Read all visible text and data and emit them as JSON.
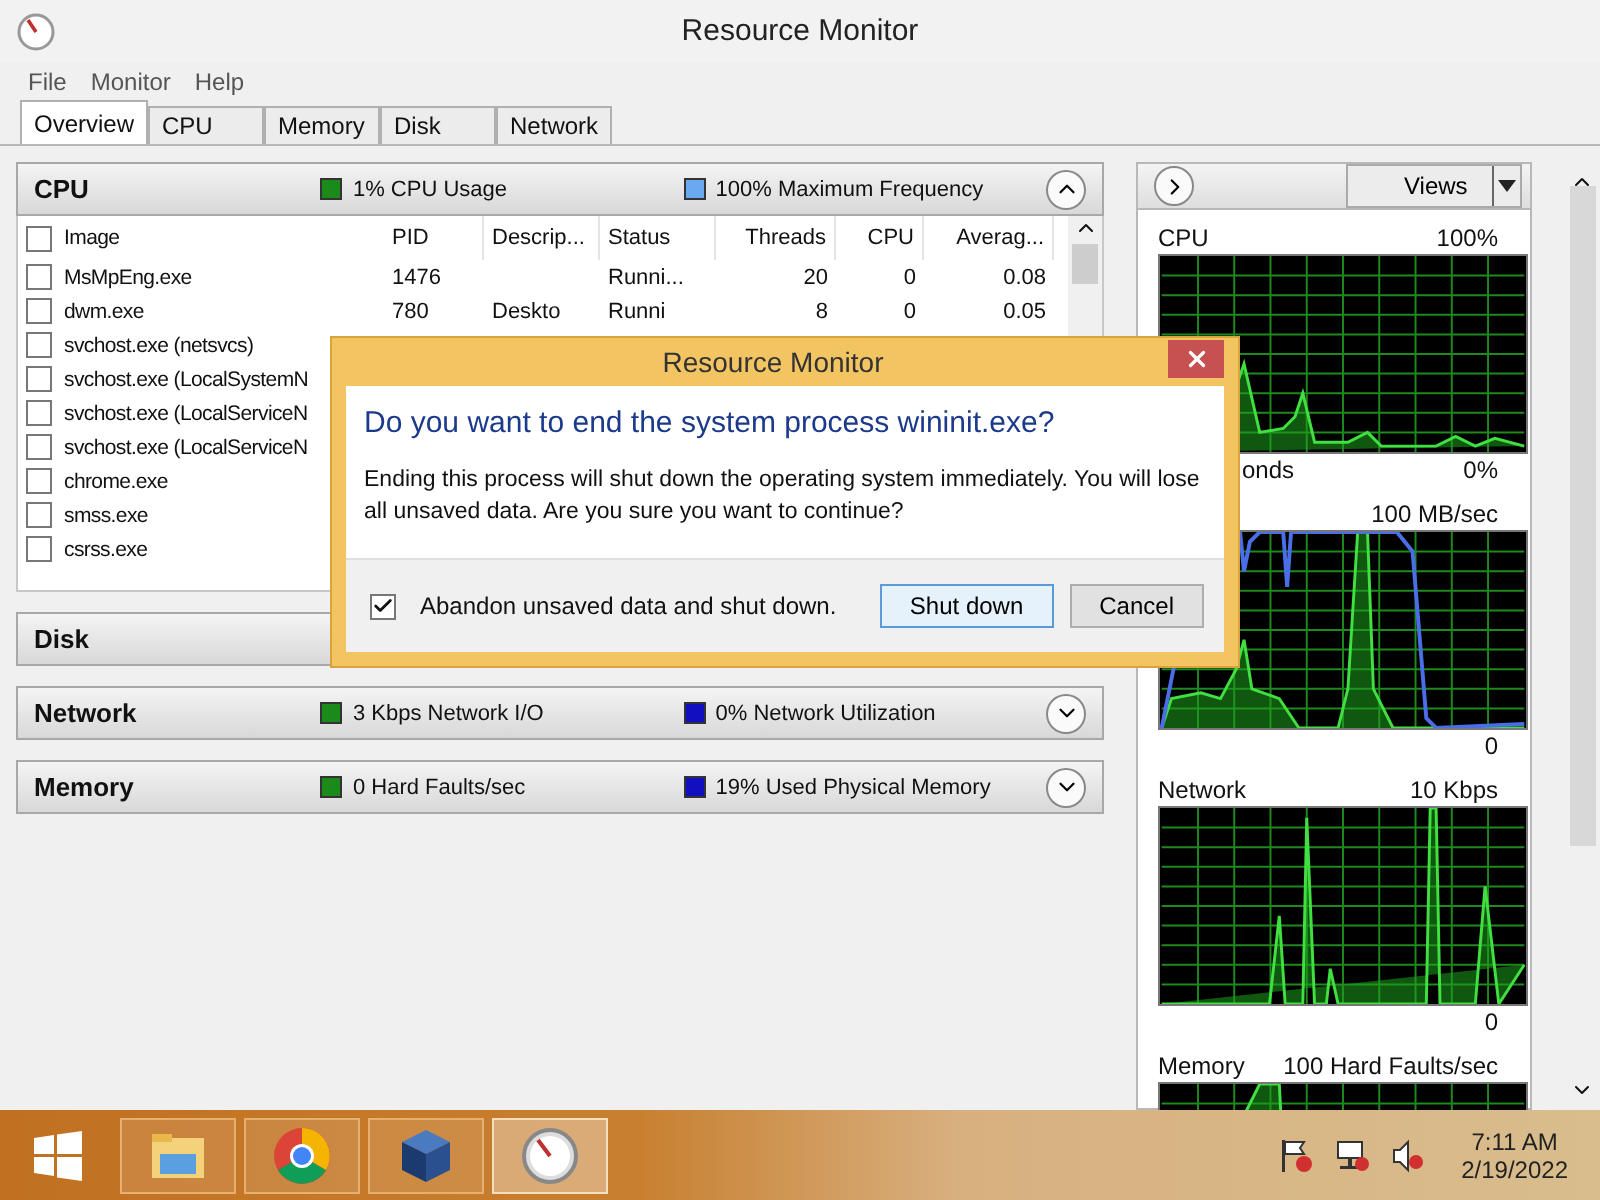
{
  "window": {
    "title": "Resource Monitor"
  },
  "menu": [
    "File",
    "Monitor",
    "Help"
  ],
  "tabs": [
    {
      "label": "Overview",
      "selected": true
    },
    {
      "label": "CPU",
      "selected": false
    },
    {
      "label": "Memory",
      "selected": false
    },
    {
      "label": "Disk",
      "selected": false
    },
    {
      "label": "Network",
      "selected": false
    }
  ],
  "sections": [
    {
      "title": "CPU",
      "expanded": true,
      "indicators": [
        {
          "text": "1% CPU Usage",
          "color": "#1a8a1a"
        },
        {
          "text": "100% Maximum Frequency",
          "color": "#6aa8f0"
        }
      ],
      "table": {
        "columns": [
          "Image",
          "PID",
          "Descrip...",
          "Status",
          "Threads",
          "CPU",
          "Averag..."
        ],
        "header_checked": false,
        "rows": [
          {
            "checked": false,
            "cells": [
              "MsMpEng.exe",
              "1476",
              "",
              "Runni...",
              "20",
              "0",
              "0.08"
            ]
          },
          {
            "checked": false,
            "cells": [
              "dwm.exe",
              "780",
              "Deskto",
              "Runni",
              "8",
              "0",
              "0.05"
            ]
          },
          {
            "checked": false,
            "cells": [
              "svchost.exe (netsvcs)"
            ]
          },
          {
            "checked": false,
            "cells": [
              "svchost.exe (LocalSystemN"
            ]
          },
          {
            "checked": false,
            "cells": [
              "svchost.exe (LocalServiceN"
            ]
          },
          {
            "checked": false,
            "cells": [
              "svchost.exe (LocalServiceN"
            ]
          },
          {
            "checked": false,
            "cells": [
              "chrome.exe"
            ]
          },
          {
            "checked": false,
            "cells": [
              "smss.exe"
            ]
          },
          {
            "checked": false,
            "cells": [
              "csrss.exe"
            ]
          }
        ]
      }
    },
    {
      "title": "Disk"
    },
    {
      "title": "Network",
      "expanded": false,
      "indicators": [
        {
          "text": "3 Kbps Network I/O",
          "color": "#1a8a1a"
        },
        {
          "text": "0% Network Utilization",
          "color": "#1010c0"
        }
      ]
    },
    {
      "title": "Memory",
      "expanded": false,
      "indicators": [
        {
          "text": "0 Hard Faults/sec",
          "color": "#1a8a1a"
        },
        {
          "text": "19% Used Physical Memory",
          "color": "#1010c0"
        }
      ]
    }
  ],
  "graph_panel": {
    "views_button": "Views",
    "graphs": [
      {
        "kind": "cpu",
        "title": "CPU",
        "max": "100%",
        "footer_left": "onds",
        "min": "0%"
      },
      {
        "kind": "disk",
        "max": "100 MB/sec",
        "min": "0"
      },
      {
        "kind": "network",
        "title": "Network",
        "max": "10 Kbps",
        "min": "0"
      },
      {
        "kind": "memory",
        "title": "Memory",
        "max": "100 Hard Faults/sec"
      }
    ]
  },
  "dialog": {
    "title": "Resource Monitor",
    "heading": "Do you want to end the system process wininit.exe?",
    "body": "Ending this process will shut down the operating system immediately. You will lose all unsaved data. Are you sure you want to continue?",
    "checkbox": {
      "label": "Abandon unsaved data and shut down.",
      "checked": true
    },
    "buttons": [
      {
        "label": "Shut down",
        "default": true
      },
      {
        "label": "Cancel",
        "default": false
      }
    ]
  },
  "taskbar": {
    "apps": [
      {
        "kind": "explorer",
        "active": false
      },
      {
        "kind": "chrome",
        "active": false
      },
      {
        "kind": "virtualbox",
        "active": false
      },
      {
        "kind": "resmon",
        "active": true
      }
    ],
    "time": "7:11 AM",
    "date": "2/19/2022"
  }
}
